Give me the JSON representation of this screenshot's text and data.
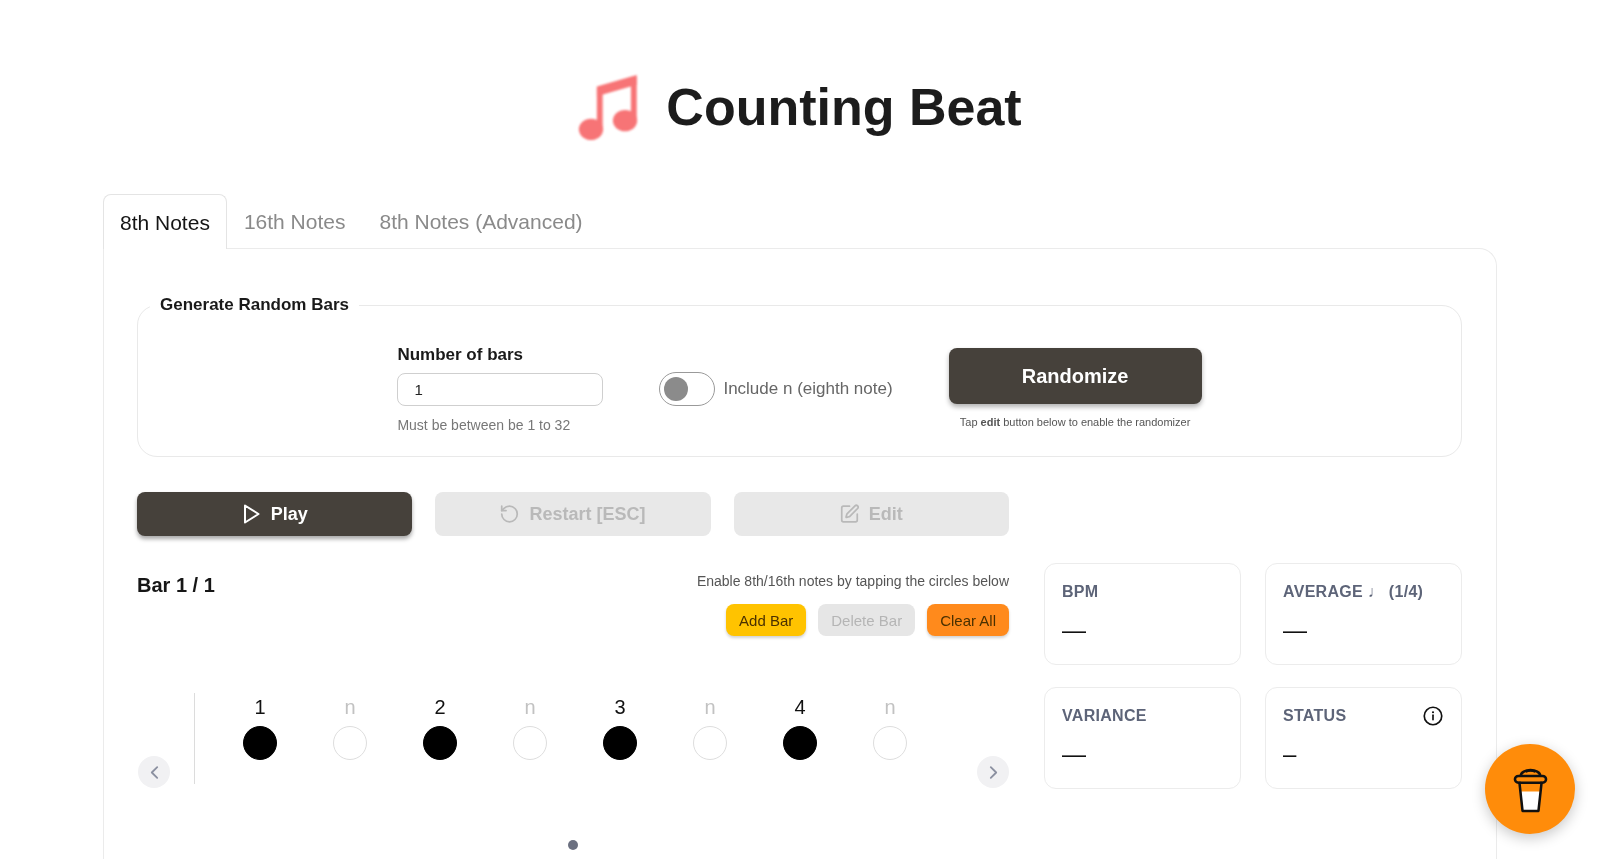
{
  "header": {
    "title": "Counting Beat"
  },
  "tabs": [
    {
      "label": "8th Notes",
      "selected": true
    },
    {
      "label": "16th Notes",
      "selected": false
    },
    {
      "label": "8th Notes (Advanced)",
      "selected": false
    }
  ],
  "generator": {
    "legend": "Generate Random Bars",
    "bars_field": {
      "label": "Number of bars",
      "value": "1",
      "helper": "Must be between be 1 to 32"
    },
    "toggle": {
      "label": "Include n (eighth note)",
      "on": false
    },
    "randomize": {
      "label": "Randomize",
      "note": "Tap **edit** button below to enable the randomizer"
    }
  },
  "transport": [
    {
      "kind": "play",
      "label": "Play",
      "disabled": false
    },
    {
      "kind": "restart",
      "label": "Restart [ESC]",
      "disabled": true
    },
    {
      "kind": "edit",
      "label": "Edit",
      "disabled": true
    }
  ],
  "bar_editor": {
    "title": "Bar 1 / 1",
    "hint": "Enable 8th/16th notes by tapping the circles below",
    "actions": [
      {
        "label": "Add Bar",
        "color": "#ffc300",
        "disabled": false
      },
      {
        "label": "Delete Bar",
        "color": "#e6e6e6",
        "disabled": true
      },
      {
        "label": "Clear All",
        "color": "#ff8a1c",
        "disabled": false
      }
    ],
    "beats": [
      {
        "kind": "count",
        "label": "1",
        "on": true
      },
      {
        "kind": "subdivision",
        "label": "n",
        "on": false
      },
      {
        "kind": "count",
        "label": "2",
        "on": true
      },
      {
        "kind": "subdivision",
        "label": "n",
        "on": false
      },
      {
        "kind": "count",
        "label": "3",
        "on": true
      },
      {
        "kind": "subdivision",
        "label": "n",
        "on": false
      },
      {
        "kind": "count",
        "label": "4",
        "on": true
      },
      {
        "kind": "subdivision",
        "label": "n",
        "on": false
      }
    ],
    "pages": [
      {
        "selected": true
      }
    ]
  },
  "stats": [
    {
      "label": "BPM",
      "value": "—",
      "info": false
    },
    {
      "label": "AVERAGE ♩ (1/4)",
      "value": "—",
      "info": false
    },
    {
      "label": "VARIANCE",
      "value": "—",
      "info": false
    },
    {
      "label": "STATUS",
      "value": "–",
      "info": true
    }
  ]
}
